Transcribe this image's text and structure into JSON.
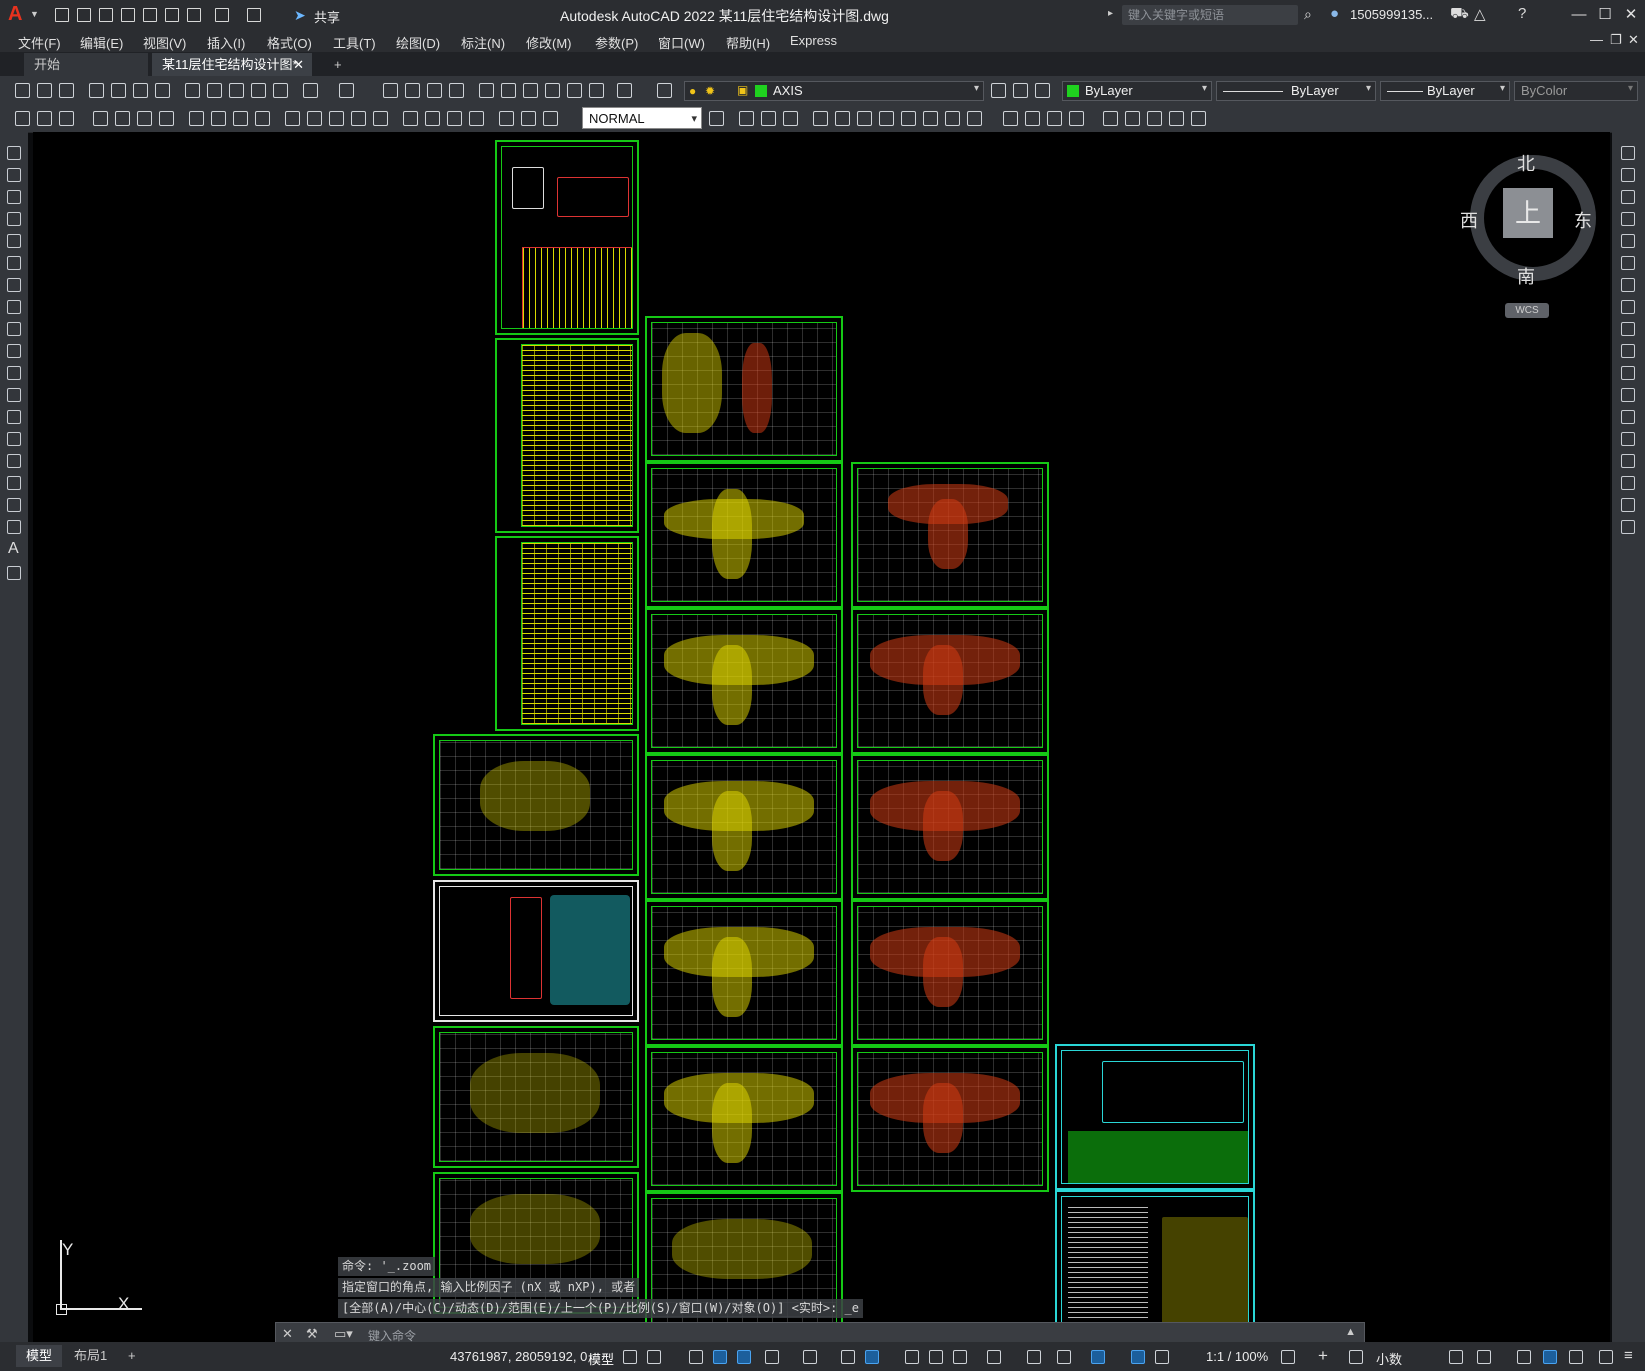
{
  "app": {
    "logo": "A",
    "title": "Autodesk AutoCAD 2022    某11层住宅结构设计图.dwg",
    "share_label": "共享",
    "search_placeholder": "键入关键字或短语",
    "user": "1505999135...",
    "minimize": "—",
    "restore": "☐",
    "close": "✕"
  },
  "menu": [
    "文件(F)",
    "编辑(E)",
    "视图(V)",
    "插入(I)",
    "格式(O)",
    "工具(T)",
    "绘图(D)",
    "标注(N)",
    "修改(M)",
    "参数(P)",
    "窗口(W)",
    "帮助(H)",
    "Express"
  ],
  "tabs": {
    "start": "开始",
    "document": "某11层住宅结构设计图*",
    "add": "+"
  },
  "toolbar": {
    "layer": "AXIS",
    "color": "ByLayer",
    "linetype": "ByLayer",
    "lineweight": "ByLayer",
    "plotstyle": "ByColor",
    "dimstyle": "NORMAL"
  },
  "viewcube": {
    "north": "北",
    "south": "南",
    "east": "东",
    "west": "西",
    "top": "上",
    "wcs": "WCS"
  },
  "ucs": {
    "x": "X",
    "y": "Y"
  },
  "command": {
    "history": [
      "命令: '_.zoom",
      "指定窗口的角点, 输入比例因子 (nX 或 nXP), 或者",
      "[全部(A)/中心(C)/动态(D)/范围(E)/上一个(P)/比例(S)/窗口(W)/对象(O)] <实时>: _e"
    ],
    "placeholder": "键入命令"
  },
  "status": {
    "tab_model": "模型",
    "tab_layout": "布局1",
    "tab_add": "+",
    "coords": "43761987, 28059192, 0",
    "space": "模型",
    "scale": "1:1 / 100%",
    "units": "小数"
  },
  "colors": {
    "sheet_border": "#15c915",
    "highlight_border": "#2ad6d6",
    "table_fill": "#d9d900",
    "canvas": "#000000"
  }
}
